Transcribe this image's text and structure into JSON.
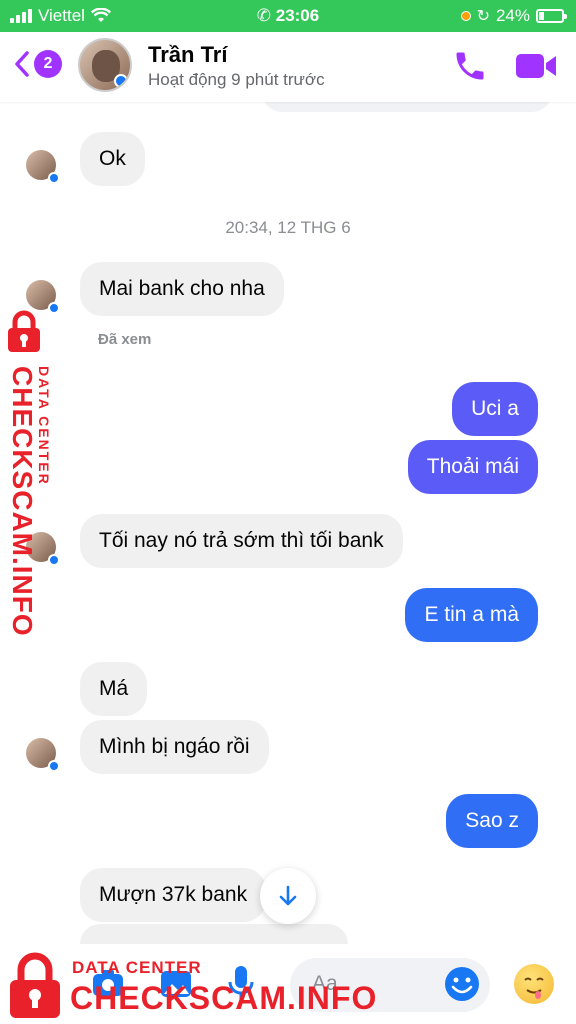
{
  "status_bar": {
    "carrier": "Viettel",
    "time": "23:06",
    "battery_percent": "24%",
    "battery_level": 0.24
  },
  "header": {
    "back_badge": "2",
    "contact_name": "Trần Trí",
    "contact_status": "Hoạt động 9 phút trước",
    "accent_color": "#a033ff"
  },
  "messages": [
    {
      "side": "in",
      "text": "Ok"
    },
    {
      "type": "timestamp",
      "text": "20:34, 12 THG 6"
    },
    {
      "side": "in",
      "text": "Mai bank cho nha"
    },
    {
      "type": "seen",
      "text": "Đã xem"
    },
    {
      "side": "out",
      "text": "Uci a"
    },
    {
      "side": "out",
      "text": "Thoải mái"
    },
    {
      "side": "in",
      "text": "Tối nay nó trả sớm thì tối bank"
    },
    {
      "side": "out",
      "text": "E tin a mà"
    },
    {
      "side": "in",
      "text": "Má"
    },
    {
      "side": "in",
      "text": "Mình bị ngáo rồi"
    },
    {
      "side": "out",
      "text": "Sao z"
    },
    {
      "side": "in",
      "text": "Mượn 37k bank"
    }
  ],
  "composer": {
    "placeholder": "Aa"
  },
  "watermark": {
    "line1": "DATA CENTER",
    "line2": "CHECKSCAM.INFO",
    "color": "#e8212a"
  },
  "colors": {
    "outgoing_bubble": "#5b5bf7",
    "outgoing_bubble_alt": "#2f6ef5",
    "incoming_bubble": "#f0f0f0",
    "status_bar": "#34c759"
  }
}
